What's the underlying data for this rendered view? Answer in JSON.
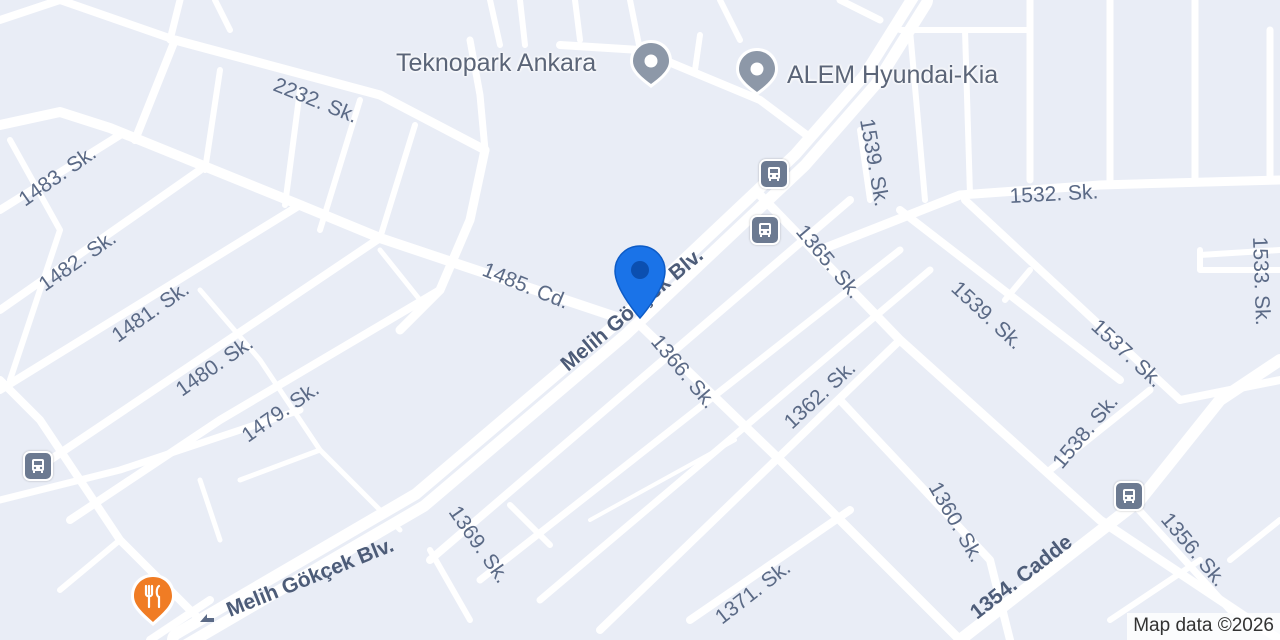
{
  "map": {
    "streets": [
      {
        "id": "2232-sk",
        "label": "2232. Sk."
      },
      {
        "id": "1483-sk",
        "label": "1483. Sk."
      },
      {
        "id": "1482-sk",
        "label": "1482. Sk."
      },
      {
        "id": "1481-sk",
        "label": "1481. Sk."
      },
      {
        "id": "1480-sk",
        "label": "1480. Sk."
      },
      {
        "id": "1479-sk",
        "label": "1479. Sk."
      },
      {
        "id": "1485-cd",
        "label": "1485. Cd."
      },
      {
        "id": "melih-gokcek-blv-upper",
        "label": "Melih Gökçek Blv."
      },
      {
        "id": "melih-gokcek-blv-lower",
        "label": "Melih Gökçek Blv."
      },
      {
        "id": "1366-sk",
        "label": "1366. Sk."
      },
      {
        "id": "1365-sk",
        "label": "1365. Sk."
      },
      {
        "id": "1539-sk-top",
        "label": "1539. Sk."
      },
      {
        "id": "1539-sk",
        "label": "1539. Sk."
      },
      {
        "id": "1532-sk",
        "label": "1532. Sk."
      },
      {
        "id": "1537-sk",
        "label": "1537. Sk."
      },
      {
        "id": "1533-sk",
        "label": "1533. Sk."
      },
      {
        "id": "1538-sk",
        "label": "1538. Sk."
      },
      {
        "id": "1362-sk",
        "label": "1362. Sk."
      },
      {
        "id": "1369-sk",
        "label": "1369. Sk."
      },
      {
        "id": "1371-sk",
        "label": "1371. Sk."
      },
      {
        "id": "1360-sk",
        "label": "1360. Sk."
      },
      {
        "id": "1354-cadde",
        "label": "1354. Cadde"
      },
      {
        "id": "1356-sk",
        "label": "1356. Sk."
      }
    ],
    "pois": [
      {
        "id": "teknopark-ankara",
        "label": "Teknopark Ankara",
        "icon": "location-pin-icon"
      },
      {
        "id": "alem-hyundai-kia",
        "label": "ALEM Hyundai-Kia",
        "icon": "location-pin-icon"
      }
    ],
    "bus_stops": 4,
    "restaurant_icon": "restaurant-icon",
    "selected_marker_icon": "map-marker-icon",
    "attribution": "Map data ©2026",
    "colors": {
      "background": "#e9edf6",
      "road": "#ffffff",
      "marker": "#1a73e8",
      "restaurant": "#f07c24",
      "bus_stop": "#6c7a91",
      "poi_pin": "#8d98a8"
    }
  }
}
